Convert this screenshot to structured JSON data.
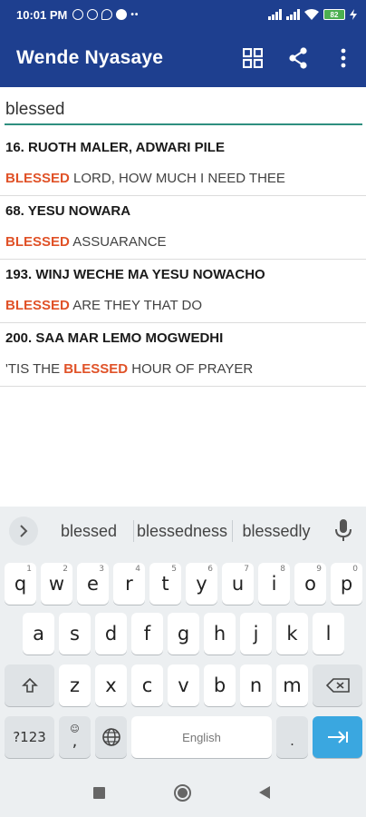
{
  "status_bar": {
    "time": "10:01 PM",
    "battery": "82",
    "left_icons": [
      "alarm-icon",
      "whatsapp-icon",
      "chat-bubble-icon",
      "circle-app-icon",
      "more-dots-icon"
    ],
    "right_icons": [
      "signal-icon",
      "signal-icon",
      "wifi-icon",
      "battery-icon",
      "charging-icon"
    ]
  },
  "app_bar": {
    "title": "Wende Nyasaye",
    "actions": [
      "grid-view-icon",
      "share-icon",
      "overflow-menu-icon"
    ],
    "color": "#1e3f8f"
  },
  "search": {
    "value": "blessed",
    "accent": "#2f8f7f"
  },
  "results": [
    {
      "title": "16. RUOTH MALER, ADWARI PILE",
      "before": "",
      "match": "BLESSED",
      "after": " LORD, HOW MUCH I NEED THEE"
    },
    {
      "title": "68. YESU NOWARA",
      "before": "",
      "match": "BLESSED",
      "after": " ASSUARANCE"
    },
    {
      "title": "193. WINJ WECHE MA YESU NOWACHO",
      "before": "",
      "match": "BLESSED",
      "after": " ARE THEY THAT DO"
    },
    {
      "title": "200. SAA MAR LEMO MOGWEDHI",
      "before": "'TIS THE ",
      "match": "BLESSED",
      "after": " HOUR OF PRAYER"
    }
  ],
  "highlight_color": "#e05228",
  "keyboard": {
    "suggestions": [
      "blessed",
      "blessedness",
      "blessedly"
    ],
    "row1": [
      {
        "k": "q",
        "h": "1"
      },
      {
        "k": "w",
        "h": "2"
      },
      {
        "k": "e",
        "h": "3"
      },
      {
        "k": "r",
        "h": "4"
      },
      {
        "k": "t",
        "h": "5"
      },
      {
        "k": "y",
        "h": "6"
      },
      {
        "k": "u",
        "h": "7"
      },
      {
        "k": "i",
        "h": "8"
      },
      {
        "k": "o",
        "h": "9"
      },
      {
        "k": "p",
        "h": "0"
      }
    ],
    "row2": [
      "a",
      "s",
      "d",
      "f",
      "g",
      "h",
      "j",
      "k",
      "l"
    ],
    "row3": [
      "z",
      "x",
      "c",
      "v",
      "b",
      "n",
      "m"
    ],
    "symbols_label": "?123",
    "comma_label": ",",
    "space_label": "English",
    "period_label": ".",
    "enter_color": "#3aa7e0"
  },
  "nav_bar": {
    "buttons": [
      "recents-square-icon",
      "home-circle-icon",
      "back-triangle-icon"
    ]
  }
}
